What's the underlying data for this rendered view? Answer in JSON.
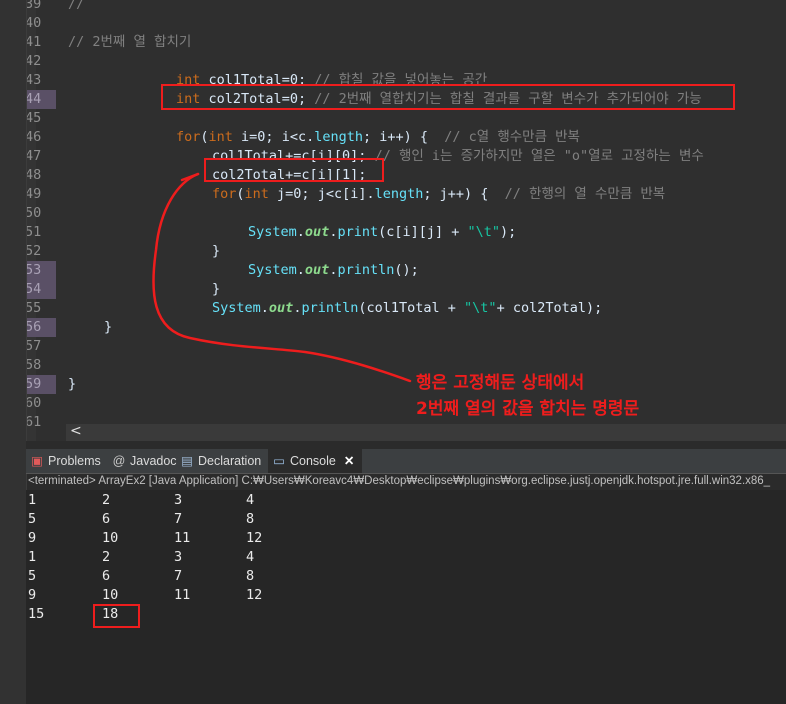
{
  "editor": {
    "lines": [
      {
        "n": "39",
        "marked": false,
        "code": "//"
      },
      {
        "n": "40",
        "marked": false,
        "code": ""
      },
      {
        "n": "41",
        "marked": false,
        "code": "// 2번째 열 합치기"
      },
      {
        "n": "42",
        "marked": false,
        "code": ""
      },
      {
        "n": "43",
        "marked": false,
        "code": "int col1Total=0; // 합칠 값을 넣어놓는 공간"
      },
      {
        "n": "44",
        "marked": true,
        "code": "int col2Total=0; // 2번째 열합치기는 합칠 결과를 구할 변수가 추가되어야 가능"
      },
      {
        "n": "45",
        "marked": false,
        "code": ""
      },
      {
        "n": "46",
        "marked": false,
        "code": "for(int i=0; i<c.length; i++) {  // c열 행수만큼 반복"
      },
      {
        "n": "47",
        "marked": false,
        "code": "col1Total+=c[i][0]; // 행인 i는 증가하지만 열은 \"o\"열로 고정하는 변수"
      },
      {
        "n": "48",
        "marked": false,
        "code": "col2Total+=c[i][1];"
      },
      {
        "n": "49",
        "marked": false,
        "code": "for(int j=0; j<c[i].length; j++) {  // 한행의 열 수만큼 반복"
      },
      {
        "n": "50",
        "marked": false,
        "code": ""
      },
      {
        "n": "51",
        "marked": false,
        "code": "System.out.print(c[i][j] + \"\\t\");"
      },
      {
        "n": "52",
        "marked": false,
        "code": "}"
      },
      {
        "n": "53",
        "marked": true,
        "code": "System.out.println();"
      },
      {
        "n": "54",
        "marked": true,
        "code": "}"
      },
      {
        "n": "55",
        "marked": false,
        "code": "System.out.println(col1Total + \"\\t\"+ col2Total);"
      },
      {
        "n": "56",
        "marked": true,
        "code": "}"
      },
      {
        "n": "57",
        "marked": false,
        "code": ""
      },
      {
        "n": "58",
        "marked": false,
        "code": ""
      },
      {
        "n": "59",
        "marked": true,
        "code": "}"
      },
      {
        "n": "60",
        "marked": false,
        "code": ""
      },
      {
        "n": "61",
        "marked": false,
        "code": ""
      }
    ],
    "scroll_left_glyph": "<"
  },
  "views": {
    "tabs": [
      {
        "label": "Problems",
        "icon": "problems-icon"
      },
      {
        "label": "Javadoc",
        "icon": "javadoc-icon"
      },
      {
        "label": "Declaration",
        "icon": "declaration-icon"
      },
      {
        "label": "Console",
        "icon": "console-icon",
        "active": true
      }
    ],
    "close_glyph": "✕"
  },
  "console": {
    "status": "<terminated> ArrayEx2 [Java Application] C:₩Users₩Koreavc4₩Desktop₩eclipse₩plugins₩org.eclipse.justj.openjdk.hotspot.jre.full.win32.x86_",
    "rows": [
      [
        "1",
        "2",
        "3",
        "4"
      ],
      [
        "5",
        "6",
        "7",
        "8"
      ],
      [
        "9",
        "10",
        "11",
        "12"
      ],
      [
        "1",
        "2",
        "3",
        "4"
      ],
      [
        "5",
        "6",
        "7",
        "8"
      ],
      [
        "9",
        "10",
        "11",
        "12"
      ],
      [
        "15",
        "18"
      ]
    ]
  },
  "annotation": {
    "line1": "행은 고정해둔 상태에서",
    "line2": "2번째 열의 값을 합치는 명령문",
    "color": "#ee1d1d"
  },
  "colors": {
    "keyword": "#cc6c1d",
    "comment": "#808080",
    "field": "#66e1f8",
    "string": "#17c6a3",
    "highlight": "#ee1d1d"
  }
}
